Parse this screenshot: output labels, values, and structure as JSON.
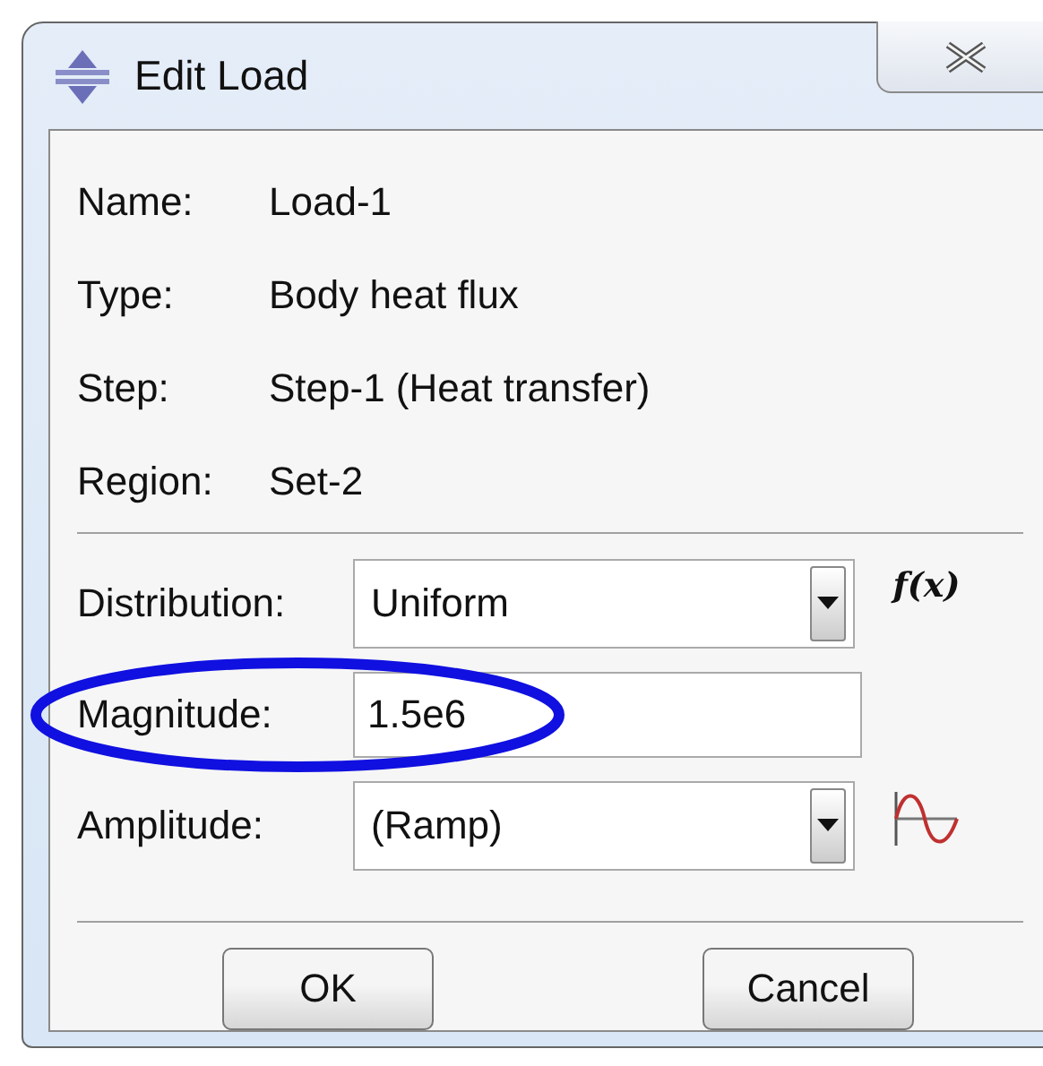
{
  "window": {
    "title": "Edit Load"
  },
  "info": [
    {
      "label": "Name:",
      "value": "Load-1"
    },
    {
      "label": "Type:",
      "value": "Body heat flux"
    },
    {
      "label": "Step:",
      "value": "Step-1 (Heat transfer)"
    },
    {
      "label": "Region:",
      "value": "Set-2"
    }
  ],
  "fields": [
    {
      "kind": "combo",
      "label": "Distribution:",
      "value": "Uniform",
      "side": {
        "kind": "label",
        "text": "f(x)"
      }
    },
    {
      "kind": "text",
      "label": "Magnitude:",
      "value": "1.5e6",
      "highlighted": true
    },
    {
      "kind": "combo",
      "label": "Amplitude:",
      "value": "(Ramp)",
      "side": {
        "kind": "wave"
      }
    }
  ],
  "buttons": [
    "OK",
    "Cancel"
  ]
}
